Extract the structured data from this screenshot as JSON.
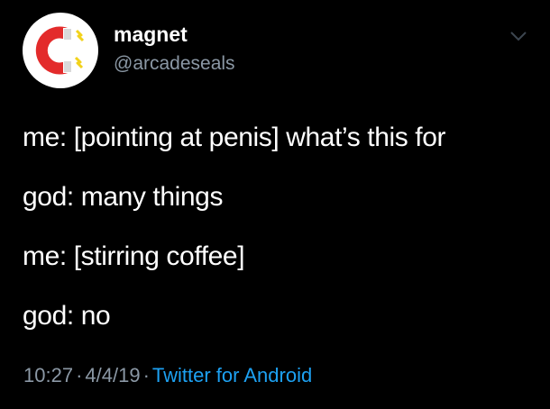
{
  "tweet": {
    "display_name": "magnet",
    "handle": "@arcadeseals",
    "lines": [
      "me: [pointing at penis] what’s this for",
      "god: many things",
      "me: [stirring coffee]",
      "god: no"
    ],
    "time": "10:27",
    "date": "4/4/19",
    "separator": "·",
    "source": "Twitter for Android"
  },
  "icons": {
    "avatar": "magnet-icon",
    "menu": "chevron-down-icon"
  },
  "colors": {
    "background": "#000000",
    "text": "#ffffff",
    "secondary": "#8b98a5",
    "link": "#1da1f2",
    "magnet_red": "#e32b2b",
    "spark_yellow": "#f2d21b"
  }
}
